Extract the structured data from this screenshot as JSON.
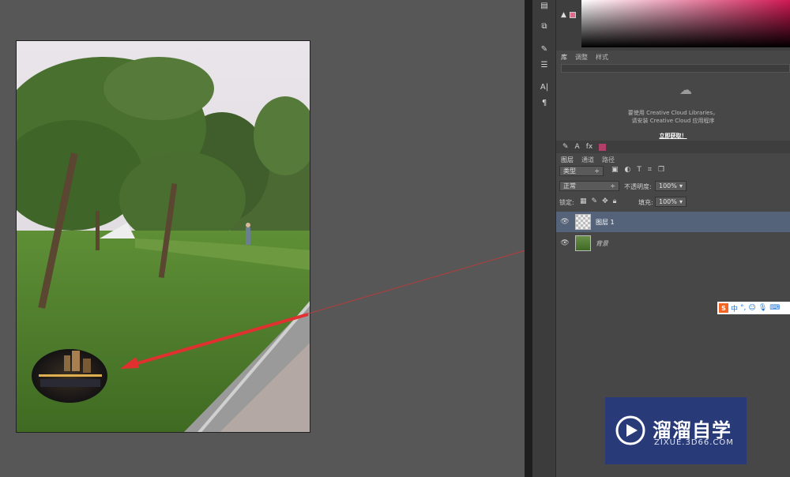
{
  "library": {
    "tabs": [
      "库",
      "调整",
      "样式"
    ],
    "message_line1": "要使用 Creative Cloud Libraries，",
    "message_line2": "请安装 Creative Cloud 应用程序",
    "link": "立即获取！"
  },
  "layers_panel": {
    "tabs": [
      "图层",
      "通道",
      "路径"
    ],
    "filter_label": "类型",
    "blend_mode": "正常",
    "opacity_label": "不透明度:",
    "opacity_value": "100%",
    "lock_label": "锁定:",
    "fill_label": "填充:",
    "fill_value": "100%",
    "layers": [
      {
        "name": "图层 1",
        "selected": true
      },
      {
        "name": "背景",
        "selected": false
      }
    ]
  },
  "ime_toolbar": {
    "label": "中"
  },
  "watermark": {
    "title": "溜溜自学",
    "url": "ZIXUE.3D66.COM"
  },
  "colors": {
    "accent": "#d01854",
    "arrow": "#e03030",
    "selected_layer": "#54627a"
  }
}
